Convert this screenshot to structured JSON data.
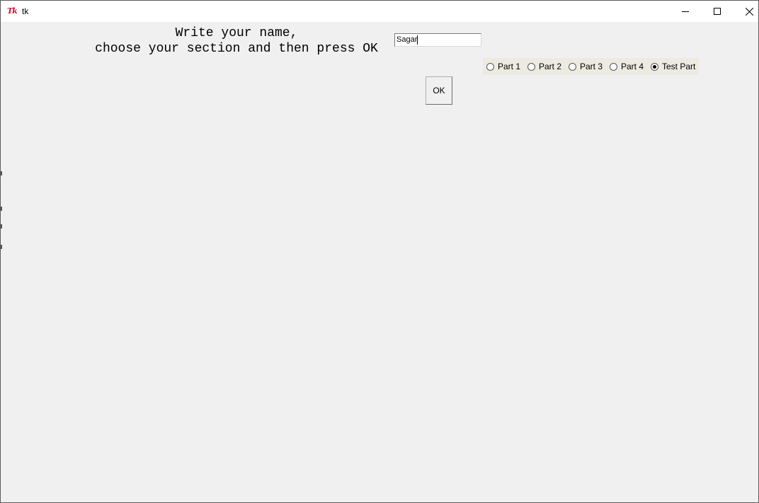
{
  "window": {
    "title": "tk",
    "icon": "tk-feather-icon",
    "icon_text": "Tk",
    "controls": [
      "minimize-icon",
      "maximize-icon",
      "close-icon"
    ]
  },
  "form": {
    "prompt_line1": "Write your name,",
    "prompt_line2": "choose your section and then press OK",
    "name_value": "Sagar",
    "sections": [
      {
        "label": "Part 1",
        "selected": false
      },
      {
        "label": "Part 2",
        "selected": false
      },
      {
        "label": "Part 3",
        "selected": false
      },
      {
        "label": "Part 4",
        "selected": false
      },
      {
        "label": "Test Part",
        "selected": true
      }
    ],
    "ok_label": "OK"
  },
  "colors": {
    "background": "#f0f0f0",
    "titlebar": "#ffffff",
    "radio_group_bg": "#ecebe2",
    "tk_icon": "#c8102e"
  }
}
